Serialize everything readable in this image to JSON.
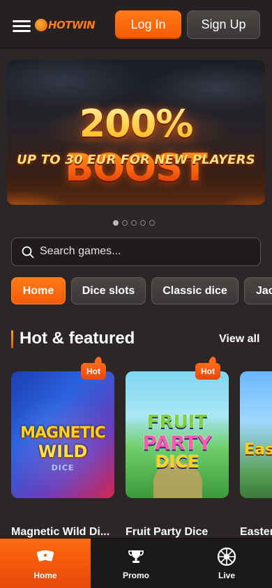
{
  "header": {
    "logo_text": "HOTWIN",
    "login_label": "Log In",
    "signup_label": "Sign Up"
  },
  "banner": {
    "title": "200% BOOST",
    "subtitle": "UP TO 30 EUR FOR NEW PLAYERS",
    "slide_count": 5,
    "active_slide": 1
  },
  "search": {
    "placeholder": "Search games..."
  },
  "categories": [
    {
      "label": "Home",
      "active": true
    },
    {
      "label": "Dice slots",
      "active": false
    },
    {
      "label": "Classic dice",
      "active": false
    },
    {
      "label": "Jac",
      "active": false
    }
  ],
  "section": {
    "title": "Hot & featured",
    "view_all": "View all"
  },
  "games": [
    {
      "title": "Magnetic Wild Di...",
      "badge": "Hot",
      "art_lines": [
        "MAGNETIC",
        "WILD",
        "DICE"
      ]
    },
    {
      "title": "Fruit Party Dice",
      "badge": "Hot",
      "art_lines": [
        "FRUIT",
        "PARTY",
        "DICE"
      ]
    },
    {
      "title": "Easter",
      "badge": "",
      "art_lines": [
        "Eas"
      ]
    }
  ],
  "bottom_nav": [
    {
      "label": "Home",
      "icon": "cards-icon",
      "active": true
    },
    {
      "label": "Promo",
      "icon": "trophy-icon",
      "active": false
    },
    {
      "label": "Live",
      "icon": "roulette-icon",
      "active": false
    }
  ],
  "colors": {
    "accent": "#f45a05",
    "background": "#2a2726",
    "header_bg": "#242120"
  }
}
